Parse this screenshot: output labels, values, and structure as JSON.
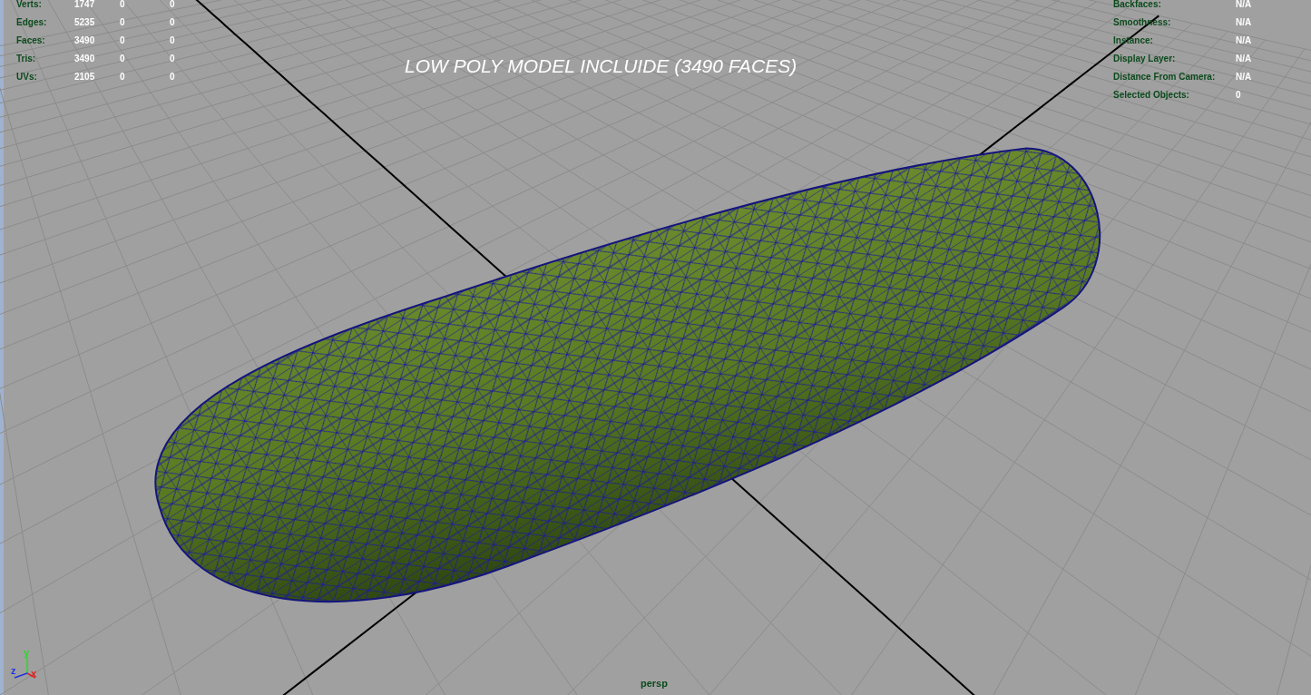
{
  "viewport_title": "LOW POLY MODEL INCLUIDE (3490 FACES)",
  "poly_stats": [
    {
      "label": "Verts:",
      "value": "1747",
      "column_3": "0",
      "column_4": "0"
    },
    {
      "label": "Edges:",
      "value": "5235",
      "column_3": "0",
      "column_4": "0"
    },
    {
      "label": "Faces:",
      "value": "3490",
      "column_3": "0",
      "column_4": "0"
    },
    {
      "label": "Tris:",
      "value": "3490",
      "column_3": "0",
      "column_4": "0"
    },
    {
      "label": "UVs:",
      "value": "2105",
      "column_3": "0",
      "column_4": "0"
    }
  ],
  "object_details": [
    {
      "label": "Backfaces:",
      "value": "N/A"
    },
    {
      "label": "Smoothness:",
      "value": "N/A"
    },
    {
      "label": "Instance:",
      "value": "N/A"
    },
    {
      "label": "Display Layer:",
      "value": "N/A"
    },
    {
      "label": "Distance From Camera:",
      "value": "N/A"
    },
    {
      "label": "Selected Objects:",
      "value": "0"
    }
  ],
  "axis_labels": {
    "y": "y",
    "z": "z",
    "x": "x"
  },
  "camera_name": "persp"
}
